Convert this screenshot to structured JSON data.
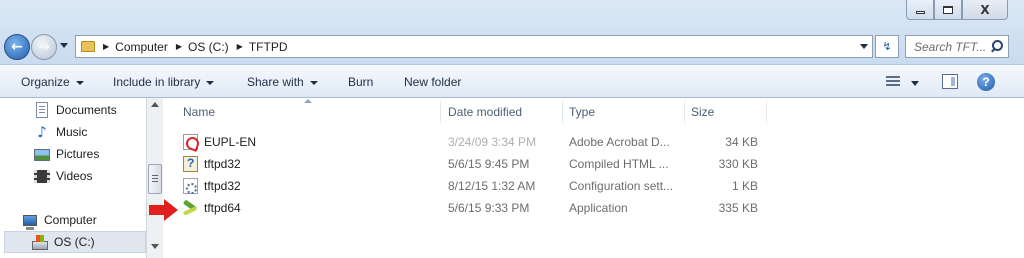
{
  "window": {
    "controls": {
      "minimize": "minimize",
      "maximize": "maximize",
      "close": "X"
    }
  },
  "nav": {
    "back_icon": "back-arrow-icon",
    "forward_icon": "forward-arrow-icon",
    "back_glyph": "←",
    "forward_glyph": "→"
  },
  "address": {
    "crumbs": [
      "Computer",
      "OS (C:)",
      "TFTPD"
    ]
  },
  "refresh_glyph": "↯",
  "search": {
    "placeholder": "Search TFT..."
  },
  "toolbar": {
    "organize": "Organize",
    "include_in_library": "Include in library",
    "share_with": "Share with",
    "burn": "Burn",
    "new_folder": "New folder",
    "help": "?"
  },
  "sidebar": {
    "items": [
      {
        "label": "Documents",
        "icon": "documents-icon"
      },
      {
        "label": "Music",
        "icon": "music-icon"
      },
      {
        "label": "Pictures",
        "icon": "pictures-icon"
      },
      {
        "label": "Videos",
        "icon": "videos-icon"
      },
      {
        "label": "Computer",
        "icon": "computer-icon"
      },
      {
        "label": "OS (C:)",
        "icon": "drive-icon"
      }
    ],
    "music_glyph": "♪"
  },
  "columns": {
    "name": "Name",
    "date_modified": "Date modified",
    "type": "Type",
    "size": "Size"
  },
  "files": [
    {
      "name": "EUPL-EN",
      "date": "3/24/09 3:34 PM",
      "type": "Adobe Acrobat D...",
      "size": "34 KB",
      "icon": "pdf-icon"
    },
    {
      "name": "tftpd32",
      "date": "5/6/15 9:45 PM",
      "type": "Compiled HTML ...",
      "size": "330 KB",
      "icon": "chm-help-icon"
    },
    {
      "name": "tftpd32",
      "date": "8/12/15 1:32 AM",
      "type": "Configuration sett...",
      "size": "1 KB",
      "icon": "config-file-icon"
    },
    {
      "name": "tftpd64",
      "date": "5/6/15 9:33 PM",
      "type": "Application",
      "size": "335 KB",
      "icon": "application-icon"
    }
  ],
  "annotation": {
    "arrow_color": "#e0201e"
  }
}
